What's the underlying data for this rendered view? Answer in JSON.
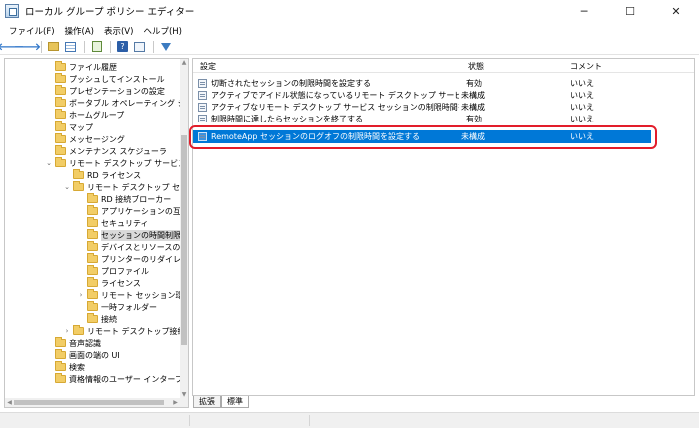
{
  "window": {
    "title": "ローカル グループ ポリシー エディター",
    "minimize": "─",
    "maximize": "☐",
    "close": "✕"
  },
  "menu": [
    "ファイル(F)",
    "操作(A)",
    "表示(V)",
    "ヘルプ(H)"
  ],
  "toolbar": {
    "back": "🡐",
    "forward": "🡒",
    "help": "?"
  },
  "tree": {
    "items": [
      {
        "label": "ファイル履歴",
        "chevron": ""
      },
      {
        "label": "プッシュしてインストール",
        "chevron": ""
      },
      {
        "label": "プレゼンテーションの設定",
        "chevron": ""
      },
      {
        "label": "ポータブル オペレーティング システ",
        "chevron": ""
      },
      {
        "label": "ホームグループ",
        "chevron": ""
      },
      {
        "label": "マップ",
        "chevron": ""
      },
      {
        "label": "メッセージング",
        "chevron": ""
      },
      {
        "label": "メンテナンス スケジューラ",
        "chevron": ""
      },
      {
        "label": "リモート デスクトップ サービス",
        "chevron": "⌄"
      },
      {
        "label": "RD ライセンス",
        "chevron": ""
      },
      {
        "label": "リモート デスクトップ セッション",
        "chevron": "⌄"
      },
      {
        "label": "RD 接続ブローカー",
        "chevron": ""
      },
      {
        "label": "アプリケーションの互換性",
        "chevron": ""
      },
      {
        "label": "セキュリティ",
        "chevron": ""
      },
      {
        "label": "セッションの時間制限",
        "chevron": ""
      },
      {
        "label": "デバイスとリソースのリダイ",
        "chevron": ""
      },
      {
        "label": "プリンターのリダイレクト",
        "chevron": ""
      },
      {
        "label": "プロファイル",
        "chevron": ""
      },
      {
        "label": "ライセンス",
        "chevron": ""
      },
      {
        "label": "リモート セッション環境",
        "chevron": "›"
      },
      {
        "label": "一時フォルダー",
        "chevron": ""
      },
      {
        "label": "接続",
        "chevron": ""
      },
      {
        "label": "リモート デスクトップ接続のク",
        "chevron": "›"
      },
      {
        "label": "音声認識",
        "chevron": ""
      },
      {
        "label": "画面の端の UI",
        "chevron": ""
      },
      {
        "label": "検索",
        "chevron": ""
      },
      {
        "label": "資格情報のユーザー インターフェ",
        "chevron": ""
      }
    ]
  },
  "list": {
    "headers": {
      "setting": "設定",
      "state": "状態",
      "comment": "コメント"
    },
    "rows": [
      {
        "name": "切断されたセッションの制限時間を設定する",
        "state": "有効",
        "comment": "いいえ"
      },
      {
        "name": "アクティブでアイドル状態になっているリモート デスクトップ サービス セッ...",
        "state": "未構成",
        "comment": "いいえ"
      },
      {
        "name": "アクティブなリモート デスクトップ サービス セッションの制限時間を設定...",
        "state": "未構成",
        "comment": "いいえ"
      },
      {
        "name": "制限時間に達したらセッションを終了する",
        "state": "有効",
        "comment": "いいえ"
      },
      {
        "name": "RemoteApp セッションのログオフの制限時間を設定する",
        "state": "未構成",
        "comment": "いいえ"
      }
    ]
  },
  "tabs": [
    "拡張",
    "標準"
  ],
  "colors": {
    "selection": "#0078d7",
    "highlight": "#e21d2a"
  }
}
